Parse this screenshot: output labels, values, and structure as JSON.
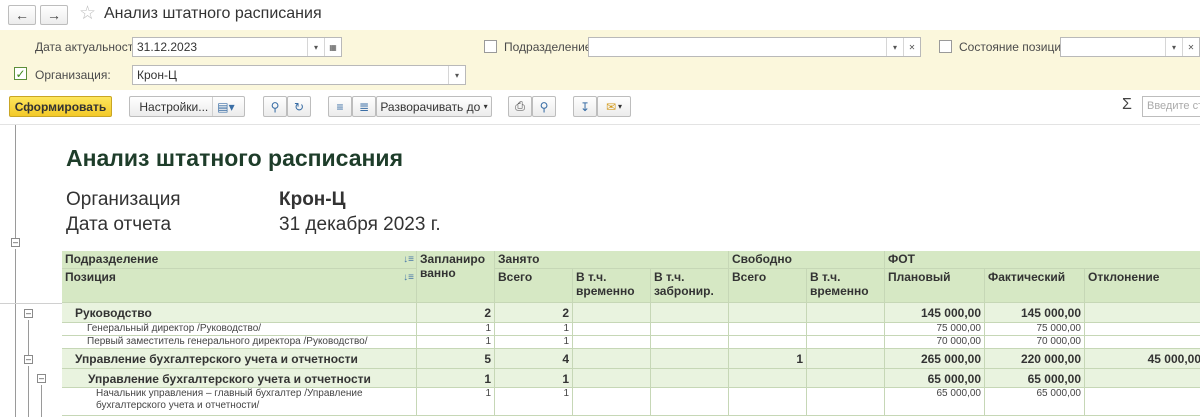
{
  "window": {
    "title": "Анализ штатного расписания"
  },
  "filters": {
    "date_label": "Дата актуальности:",
    "date_value": "31.12.2023",
    "subdivision_label": "Подразделение:",
    "subdivision_value": "",
    "state_label": "Состояние позиции:",
    "state_value": "",
    "org_label": "Организация:",
    "org_value": "Крон-Ц",
    "org_checked": true
  },
  "toolbar": {
    "generate_label": "Сформировать",
    "settings_label": "Настройки...",
    "expand_label": "Разворачивать до",
    "search_placeholder": "Введите стр"
  },
  "report": {
    "title": "Анализ штатного расписания",
    "org_label": "Организация",
    "org_value": "Крон-Ц",
    "date_label": "Дата отчета",
    "date_value": "31 декабря 2023 г."
  },
  "table": {
    "headers": {
      "subdivision": "Подразделение",
      "position": "Позиция",
      "planned": "Запланированно",
      "occupied": "Занято",
      "free": "Свободно",
      "fot": "ФОТ",
      "total": "Всего",
      "temp": "В т.ч. временно",
      "reserved": "В т.ч. забронир.",
      "free_total": "Всего",
      "free_temp": "В т.ч. временно",
      "planned_fot": "Плановый",
      "actual_fot": "Фактический",
      "deviation": "Отклонение"
    },
    "rows": [
      {
        "kind": "group",
        "name": "Руководство",
        "planned": "2",
        "occupied": "2",
        "temp": "",
        "reserved": "",
        "free": "",
        "free_temp": "",
        "plan": "145 000,00",
        "fact": "145 000,00",
        "dev": ""
      },
      {
        "kind": "detail",
        "name": "Генеральный директор /Руководство/",
        "planned": "1",
        "occupied": "1",
        "temp": "",
        "reserved": "",
        "free": "",
        "free_temp": "",
        "plan": "75 000,00",
        "fact": "75 000,00",
        "dev": ""
      },
      {
        "kind": "detail",
        "name": "Первый заместитель генерального директора /Руководство/",
        "planned": "1",
        "occupied": "1",
        "temp": "",
        "reserved": "",
        "free": "",
        "free_temp": "",
        "plan": "70 000,00",
        "fact": "70 000,00",
        "dev": ""
      },
      {
        "kind": "group",
        "name": "Управление бухгалтерского учета и отчетности",
        "planned": "5",
        "occupied": "4",
        "temp": "",
        "reserved": "",
        "free": "1",
        "free_temp": "",
        "plan": "265 000,00",
        "fact": "220 000,00",
        "dev": "45 000,00"
      },
      {
        "kind": "subgroup",
        "name": "Управление бухгалтерского учета и отчетности",
        "planned": "1",
        "occupied": "1",
        "temp": "",
        "reserved": "",
        "free": "",
        "free_temp": "",
        "plan": "65 000,00",
        "fact": "65 000,00",
        "dev": ""
      },
      {
        "kind": "detail2",
        "name": "Начальник управления – главный бухгалтер /Управление бухгалтерского учета и отчетности/",
        "planned": "1",
        "occupied": "1",
        "temp": "",
        "reserved": "",
        "free": "",
        "free_temp": "",
        "plan": "65 000,00",
        "fact": "65 000,00",
        "dev": ""
      }
    ]
  },
  "colors": {
    "accent": "#f3c928",
    "header_bg": "#d6e8c4",
    "group_bg": "#e9f3df",
    "filter_bg": "#fbf7dc"
  }
}
